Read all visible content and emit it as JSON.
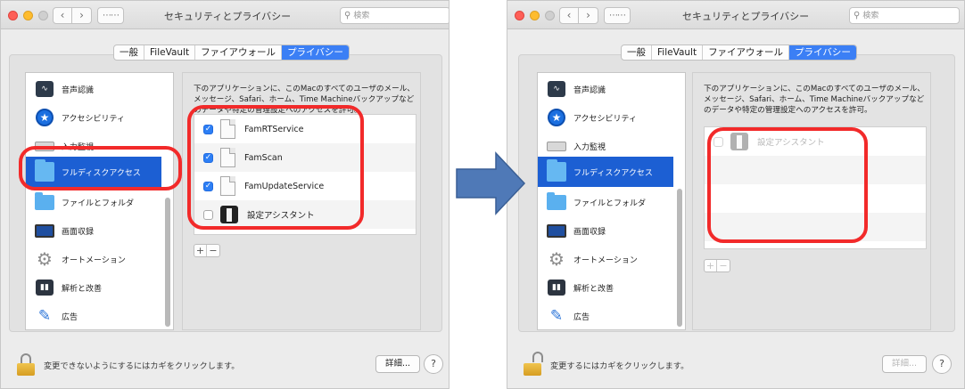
{
  "left": {
    "title": "セキュリティとプライバシー",
    "search_placeholder": "検索",
    "tabs": [
      {
        "label": "一般"
      },
      {
        "label": "FileVault"
      },
      {
        "label": "ファイアウォール"
      },
      {
        "label": "プライバシー"
      }
    ],
    "sidebar": [
      {
        "label": "音声認識",
        "icon": "waveform-icon"
      },
      {
        "label": "アクセシビリティ",
        "icon": "accessibility-icon"
      },
      {
        "label": "入力監視",
        "icon": "keyboard-icon"
      },
      {
        "label": "フルディスクアクセス",
        "icon": "folder-icon",
        "selected": true
      },
      {
        "label": "ファイルとフォルダ",
        "icon": "folder-icon"
      },
      {
        "label": "画面収録",
        "icon": "display-icon"
      },
      {
        "label": "オートメーション",
        "icon": "gear-icon"
      },
      {
        "label": "解析と改善",
        "icon": "chart-icon"
      },
      {
        "label": "広告",
        "icon": "megaphone-icon"
      }
    ],
    "description": "下のアプリケーションに、このMacのすべてのユーザのメール、メッセージ、Safari、ホーム、Time Machineバックアップなどのデータや特定の管理設定へのアクセスを許可。",
    "apps": [
      {
        "name": "FamRTService",
        "checked": true,
        "icon": "document-icon"
      },
      {
        "name": "FamScan",
        "checked": true,
        "icon": "document-icon"
      },
      {
        "name": "FamUpdateService",
        "checked": true,
        "icon": "document-icon"
      },
      {
        "name": "設定アシスタント",
        "checked": false,
        "icon": "setup-assistant-icon"
      }
    ],
    "add_label": "+",
    "remove_label": "−",
    "lock_message": "変更できないようにするにはカギをクリックします。",
    "detail_label": "詳細...",
    "help_label": "?"
  },
  "right": {
    "title": "セキュリティとプライバシー",
    "search_placeholder": "検索",
    "tabs": [
      {
        "label": "一般"
      },
      {
        "label": "FileVault"
      },
      {
        "label": "ファイアウォール"
      },
      {
        "label": "プライバシー"
      }
    ],
    "sidebar": [
      {
        "label": "音声認識",
        "icon": "waveform-icon"
      },
      {
        "label": "アクセシビリティ",
        "icon": "accessibility-icon"
      },
      {
        "label": "入力監視",
        "icon": "keyboard-icon"
      },
      {
        "label": "フルディスクアクセス",
        "icon": "folder-icon",
        "selected": true
      },
      {
        "label": "ファイルとフォルダ",
        "icon": "folder-icon"
      },
      {
        "label": "画面収録",
        "icon": "display-icon"
      },
      {
        "label": "オートメーション",
        "icon": "gear-icon"
      },
      {
        "label": "解析と改善",
        "icon": "chart-icon"
      },
      {
        "label": "広告",
        "icon": "megaphone-icon"
      }
    ],
    "description": "下のアプリケーションに、このMacのすべてのユーザのメール、メッセージ、Safari、ホーム、Time Machineバックアップなどのデータや特定の管理設定へのアクセスを許可。",
    "apps": [
      {
        "name": "設定アシスタント",
        "checked": false,
        "icon": "setup-assistant-icon"
      }
    ],
    "add_label": "+",
    "remove_label": "−",
    "lock_message": "変更するにはカギをクリックします。",
    "detail_label": "詳細...",
    "help_label": "?"
  },
  "colors": {
    "accent": "#3b7ff5",
    "selection": "#1c5fd3",
    "highlight": "#f22a2a",
    "arrow": "#4f79b7"
  }
}
